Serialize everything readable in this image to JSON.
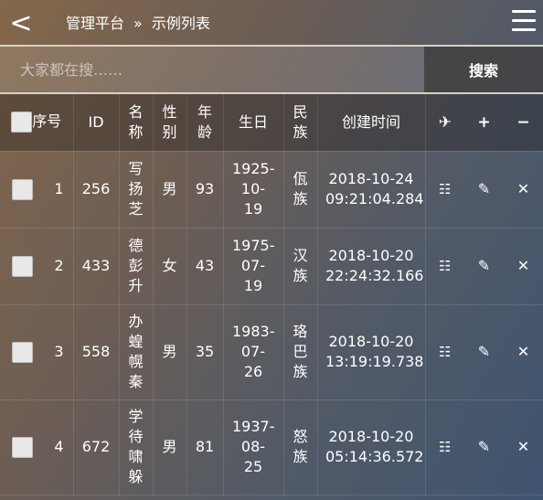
{
  "topbar": {
    "back_label": "<",
    "breadcrumb": {
      "root": "管理平台",
      "separator": "»",
      "current": "示例列表"
    }
  },
  "search": {
    "placeholder": "大家都在搜……",
    "button_label": "搜索"
  },
  "table": {
    "headers": {
      "seq": "序号",
      "id": "ID",
      "name": "名称",
      "gender": "性别",
      "age": "年龄",
      "birthday": "生日",
      "ethnicity": "民族",
      "created": "创建时间"
    },
    "header_actions": [
      "✈",
      "+",
      "−"
    ],
    "rows": [
      {
        "seq": "1",
        "id": "256",
        "name": "写扬芝",
        "gender": "男",
        "age": "93",
        "birthday": "1925-10-19",
        "ethnicity": "佤族",
        "created": "2018-10-24 09:21:04.284"
      },
      {
        "seq": "2",
        "id": "433",
        "name": "德彭升",
        "gender": "女",
        "age": "43",
        "birthday": "1975-07-19",
        "ethnicity": "汉族",
        "created": "2018-10-20 22:24:32.166"
      },
      {
        "seq": "3",
        "id": "558",
        "name": "办蝗幌秦",
        "gender": "男",
        "age": "35",
        "birthday": "1983-07-26",
        "ethnicity": "珞巴族",
        "created": "2018-10-20 13:19:19.738"
      },
      {
        "seq": "4",
        "id": "672",
        "name": "学待啸躲",
        "gender": "男",
        "age": "81",
        "birthday": "1937-08-25",
        "ethnicity": "怒族",
        "created": "2018-10-20 05:14:36.572"
      }
    ],
    "row_actions": [
      "☷",
      "✎",
      "✕"
    ]
  }
}
